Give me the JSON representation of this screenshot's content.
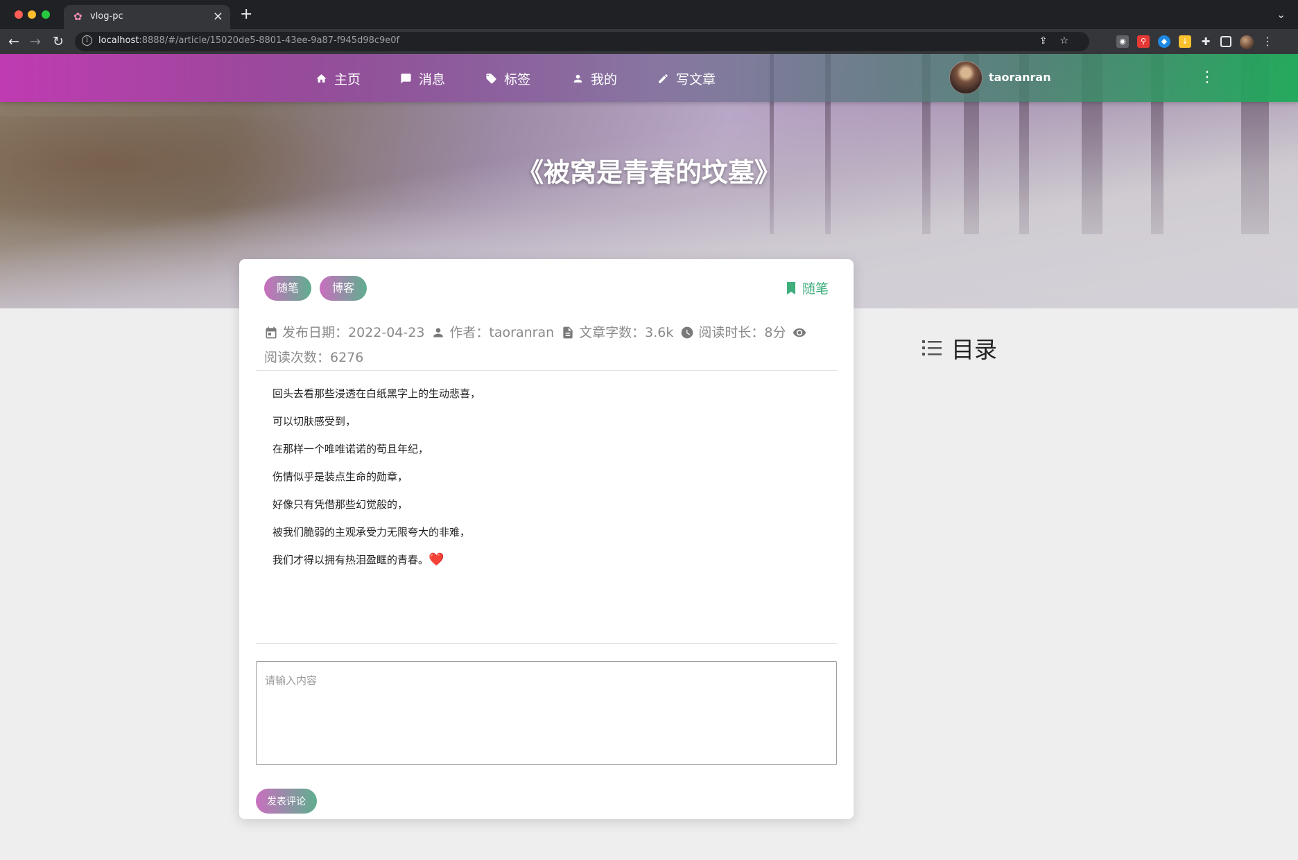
{
  "browser": {
    "tab_title": "vlog-pc",
    "url_host": "localhost",
    "url_rest": ":8888/#/article/15020de5-8801-43ee-9a87-f945d98c9e0f"
  },
  "nav": {
    "home": "主页",
    "messages": "消息",
    "tags": "标签",
    "mine": "我的",
    "write": "写文章",
    "username": "taoranran"
  },
  "article": {
    "title": "《被窝是青春的坟墓》",
    "tags": [
      "随笔",
      "博客"
    ],
    "category": "随笔",
    "meta": {
      "publish_date": "发布日期：2022-04-23",
      "author": "作者：taoranran",
      "word_count": "文章字数：3.6k",
      "read_time": "阅读时长：8分",
      "read_count": "阅读次数：6276"
    },
    "lines": [
      "回头去看那些浸透在白纸黑字上的生动悲喜，",
      "可以切肤感受到，",
      "在那样一个唯唯诺诺的苟且年纪，",
      "伤情似乎是装点生命的勋章，",
      "好像只有凭借那些幻觉般的，",
      "被我们脆弱的主观承受力无限夸大的非难，",
      "我们才得以拥有热泪盈眶的青春。"
    ],
    "heart": "❤️"
  },
  "comment": {
    "placeholder": "请输入内容",
    "submit": "发表评论"
  },
  "toc": {
    "title": "目录"
  },
  "colors": {
    "nav_gradient_start": "#c436b8",
    "nav_gradient_end": "#20aa5a",
    "chip_start": "#c96fbf",
    "chip_end": "#5fae8e",
    "category_green": "#3fae7d"
  }
}
